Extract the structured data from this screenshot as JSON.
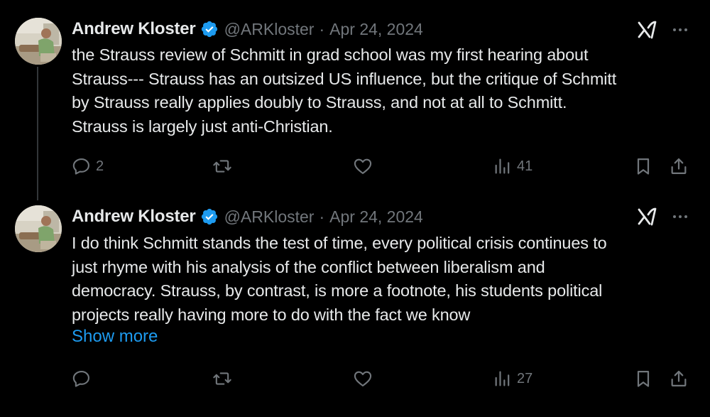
{
  "colors": {
    "background": "#000000",
    "text_primary": "#e7e9ea",
    "text_secondary": "#71767b",
    "link": "#1d9bf0",
    "verified": "#1d9bf0"
  },
  "tweets": [
    {
      "author": {
        "name": "Andrew Kloster",
        "handle": "@ARKloster",
        "verified_icon": "verified-badge-icon",
        "avatar_icon": "avatar-photo"
      },
      "separator": "·",
      "date": "Apr 24, 2024",
      "text_lines": [
        "the Strauss review of Schmitt in grad school was my first hearing about",
        "Strauss--- Strauss has an outsized US influence, but the critique of Schmitt",
        "by Strauss really applies doubly to Strauss, and not at all to Schmitt.",
        "Strauss is largely just anti-Christian."
      ],
      "metrics": {
        "replies": "2",
        "reposts": "",
        "likes": "",
        "views": "41"
      },
      "icons": {
        "grok": "grok-icon",
        "more": "more-dots-icon",
        "reply": "reply-icon",
        "repost": "repost-icon",
        "like": "heart-icon",
        "views": "views-chart-icon",
        "bookmark": "bookmark-icon",
        "share": "share-icon"
      }
    },
    {
      "author": {
        "name": "Andrew Kloster",
        "handle": "@ARKloster",
        "verified_icon": "verified-badge-icon",
        "avatar_icon": "avatar-photo"
      },
      "separator": "·",
      "date": "Apr 24, 2024",
      "text_lines": [
        "I do think Schmitt stands the test of time, every political crisis continues to",
        "just rhyme with his analysis of the conflict between liberalism and",
        "democracy.  Strauss, by contrast, is more a footnote, his students political",
        "projects really having more to do with the fact we know"
      ],
      "show_more": "Show more",
      "metrics": {
        "replies": "",
        "reposts": "",
        "likes": "",
        "views": "27"
      },
      "icons": {
        "grok": "grok-icon",
        "more": "more-dots-icon",
        "reply": "reply-icon",
        "repost": "repost-icon",
        "like": "heart-icon",
        "views": "views-chart-icon",
        "bookmark": "bookmark-icon",
        "share": "share-icon"
      }
    }
  ]
}
